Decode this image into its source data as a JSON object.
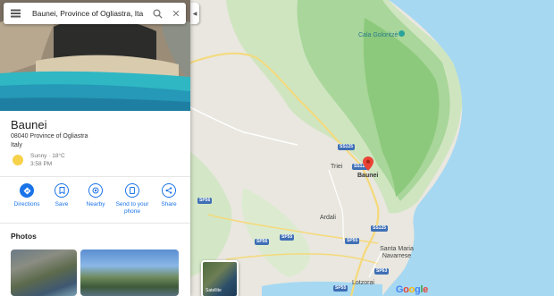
{
  "search": {
    "value": "Baunei, Province of Ogliastra, Ita"
  },
  "place": {
    "name": "Baunei",
    "address_line1": "08040 Province of Ogliastra",
    "address_line2": "Italy",
    "weather_condition": "Sunny · 18°C",
    "weather_time": "3:58 PM"
  },
  "actions": [
    {
      "label": "Directions",
      "icon": "directions-icon"
    },
    {
      "label": "Save",
      "icon": "bookmark-icon"
    },
    {
      "label": "Nearby",
      "icon": "nearby-icon"
    },
    {
      "label": "Send to your phone",
      "icon": "phone-icon"
    },
    {
      "label": "Share",
      "icon": "share-icon"
    }
  ],
  "photos": {
    "title": "Photos"
  },
  "map": {
    "labels": {
      "cala_goloritze": "Cala Goloritzè",
      "triei": "Triei",
      "baunei": "Baunei",
      "ardali": "Ardali",
      "santa_maria_navarrese": "Santa Maria Navarrese",
      "lotzorai": "Lotzorai"
    },
    "roads": {
      "ss125_a": "SS125",
      "ss125_b": "SS125",
      "ss125_c": "SS125",
      "sp56": "SP56",
      "sp55_a": "SP55",
      "sp55_b": "SP55",
      "sp56b": "SP56",
      "sp63": "SP63",
      "sp55_c": "SP55"
    },
    "satellite_label": "Satellite",
    "logo_letters": [
      "G",
      "o",
      "o",
      "g",
      "l",
      "e"
    ],
    "logo_colors": [
      "#4285F4",
      "#EA4335",
      "#FBBC05",
      "#4285F4",
      "#34A853",
      "#EA4335"
    ]
  },
  "colors": {
    "accent": "#1a73e8",
    "pin": "#ea4335",
    "sea": "#a6d8f2"
  }
}
